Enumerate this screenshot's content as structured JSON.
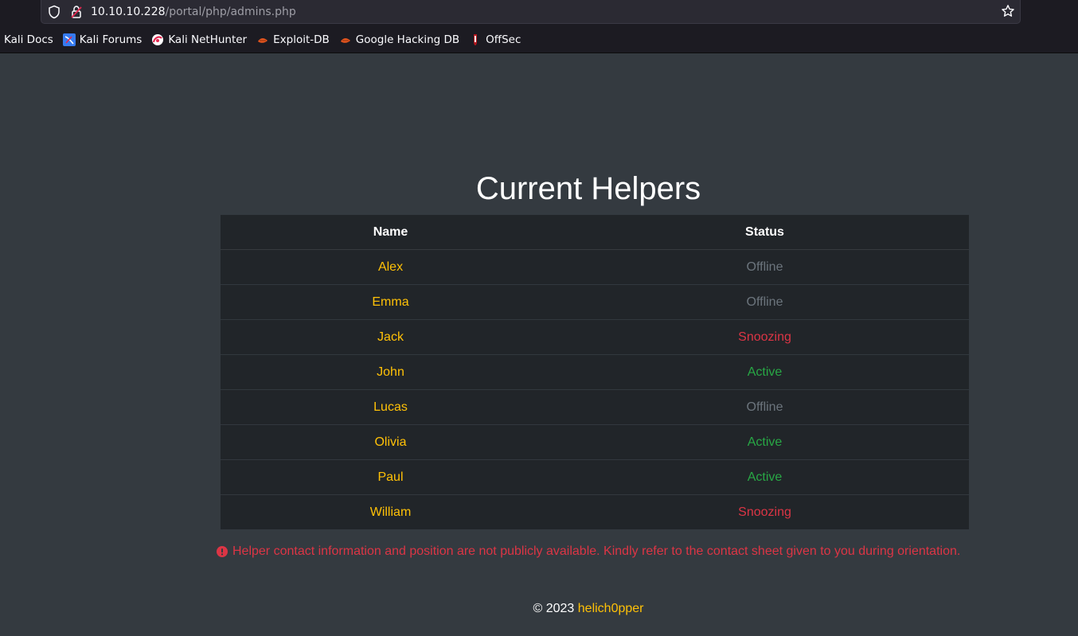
{
  "browser": {
    "url_host": "10.10.10.228",
    "url_path": "/portal/php/admins.php",
    "bookmarks": [
      {
        "label": "Kali Docs",
        "icon": "none"
      },
      {
        "label": "Kali Forums",
        "icon": "kali-forums-icon"
      },
      {
        "label": "Kali NetHunter",
        "icon": "nethunter-icon"
      },
      {
        "label": "Exploit-DB",
        "icon": "exploit-db-icon"
      },
      {
        "label": "Google Hacking DB",
        "icon": "ghdb-icon"
      },
      {
        "label": "OffSec",
        "icon": "offsec-icon"
      }
    ]
  },
  "page": {
    "title": "Current Helpers",
    "table": {
      "headers": [
        "Name",
        "Status"
      ],
      "rows": [
        {
          "name": "Alex",
          "status": "Offline"
        },
        {
          "name": "Emma",
          "status": "Offline"
        },
        {
          "name": "Jack",
          "status": "Snoozing"
        },
        {
          "name": "John",
          "status": "Active"
        },
        {
          "name": "Lucas",
          "status": "Offline"
        },
        {
          "name": "Olivia",
          "status": "Active"
        },
        {
          "name": "Paul",
          "status": "Active"
        },
        {
          "name": "William",
          "status": "Snoozing"
        }
      ]
    },
    "notice": "Helper contact information and position are not publicly available. Kindly refer to the contact sheet given to you during orientation.",
    "footer": {
      "prefix": "© 2023",
      "author": "helich0pper"
    }
  },
  "colors": {
    "background": "#343a40",
    "table_bg": "#212529",
    "name": "#ffc107",
    "offline": "#6c757d",
    "snoozing": "#dc3545",
    "active": "#28a745"
  }
}
